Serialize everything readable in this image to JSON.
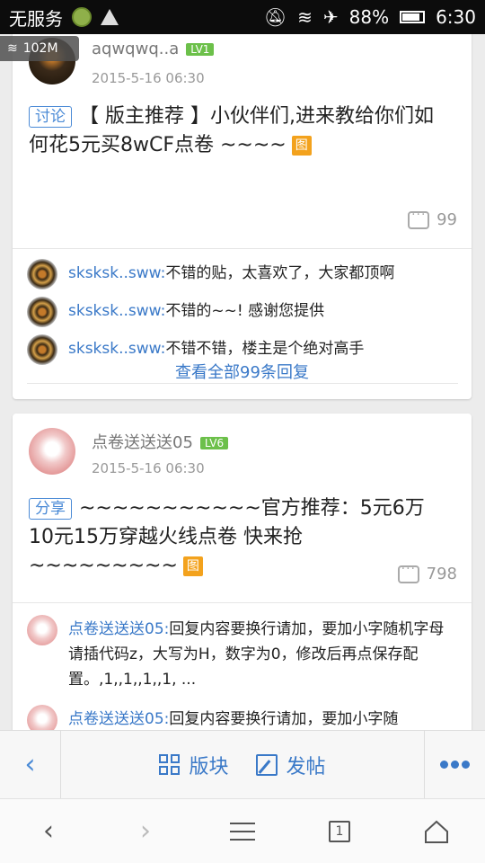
{
  "statusbar": {
    "carrier": "无服务",
    "battery": "88%",
    "battery_level": 0.88,
    "time": "6:30"
  },
  "overlay": {
    "speed": "102M"
  },
  "posts": [
    {
      "username": "aqwqwq..a",
      "level": "LV1",
      "time": "2015-5-16 06:30",
      "tag": "讨论",
      "title": "【 版主推荐 】小伙伴们,进来教给你们如何花5元买8wCF点卷 ~~~~",
      "pic_label": "图",
      "comment_count": "99",
      "replies": [
        {
          "name": "sksksk..sww:",
          "text": "不错的贴，太喜欢了，大家都顶啊"
        },
        {
          "name": "sksksk..sww:",
          "text": "不错的~~! 感谢您提供"
        },
        {
          "name": "sksksk..sww:",
          "text": "不错不错，楼主是个绝对高手"
        }
      ],
      "view_all": "查看全部99条回复"
    },
    {
      "username": "点卷送送送05",
      "level": "LV6",
      "time": "2015-5-16 06:30",
      "tag": "分享",
      "title": "~~~~~~~~~~~官方推荐：5元6万 10元15万穿越火线点卷 快来抢~~~~~~~~~",
      "pic_label": "图",
      "comment_count": "798",
      "replies": [
        {
          "name": "点卷送送送05:",
          "text": "回复内容要换行请加，要加小字随机字母请插代码z，大写为H，数字为0，修改后再点保存配置。,1,,1,,1,,1, ..."
        },
        {
          "name": "点卷送送送05:",
          "text": "回复内容要换行请加，要加小字随"
        }
      ]
    }
  ],
  "toolbar": {
    "board_label": "版块",
    "post_label": "发帖"
  },
  "navbar": {
    "tab_count": "1"
  }
}
